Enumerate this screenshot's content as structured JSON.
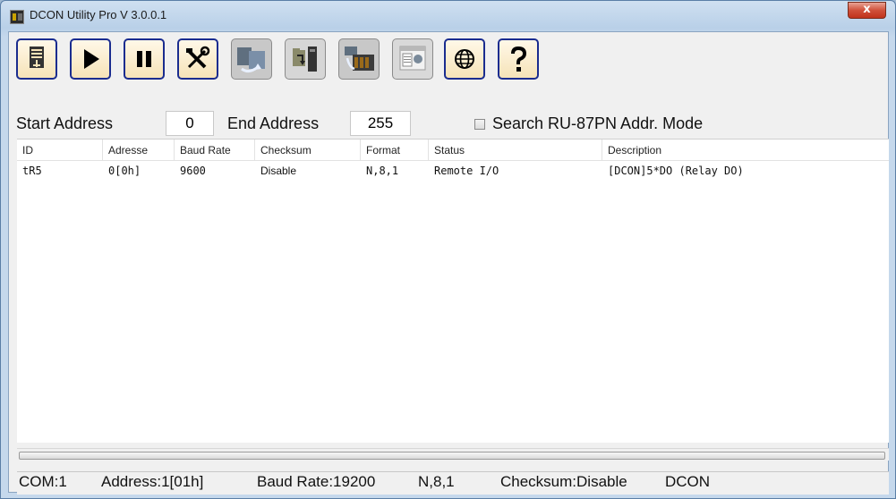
{
  "window": {
    "title": "DCON Utility Pro V 3.0.0.1",
    "close_label": "x"
  },
  "toolbar": {
    "buttons": [
      {
        "name": "com-port-icon",
        "label": "com-port-icon"
      },
      {
        "name": "play-icon",
        "label": "play-icon"
      },
      {
        "name": "pause-icon",
        "label": "pause-icon"
      },
      {
        "name": "tools-icon",
        "label": "tools-icon"
      },
      {
        "name": "module-search-icon",
        "label": "module-search-icon"
      },
      {
        "name": "open-file-icon",
        "label": "open-file-icon"
      },
      {
        "name": "io-expansion-icon",
        "label": "io-expansion-icon"
      },
      {
        "name": "terminal-window-icon",
        "label": "terminal-window-icon"
      },
      {
        "name": "globe-icon",
        "label": "globe-icon"
      },
      {
        "name": "help-icon",
        "label": "help-icon"
      }
    ]
  },
  "address": {
    "start_label": "Start Address",
    "start_value": "0",
    "end_label": "End Address",
    "end_value": "255",
    "search_mode_label": "Search RU-87PN Addr. Mode",
    "search_mode_checked": false
  },
  "table": {
    "columns": [
      "ID",
      "Adresse",
      "Baud Rate",
      "Checksum",
      "Format",
      "Status",
      "Description"
    ],
    "rows": [
      {
        "id": "tR5",
        "address": "0[0h]",
        "baud": "9600",
        "checksum": "Disable",
        "format": "N,8,1",
        "status": "Remote I/O",
        "description": "[DCON]5*DO (Relay DO)"
      }
    ]
  },
  "statusbar": {
    "com": "COM:1",
    "address": "Address:1[01h]",
    "baud": "Baud Rate:19200",
    "format": "N,8,1",
    "checksum": "Checksum:Disable",
    "protocol": "DCON"
  },
  "colors": {
    "titlebar": "#b9d0e8",
    "button_border": "#1a2c8f",
    "button_fill": "#f6e3b8",
    "close_button": "#c0331c"
  }
}
